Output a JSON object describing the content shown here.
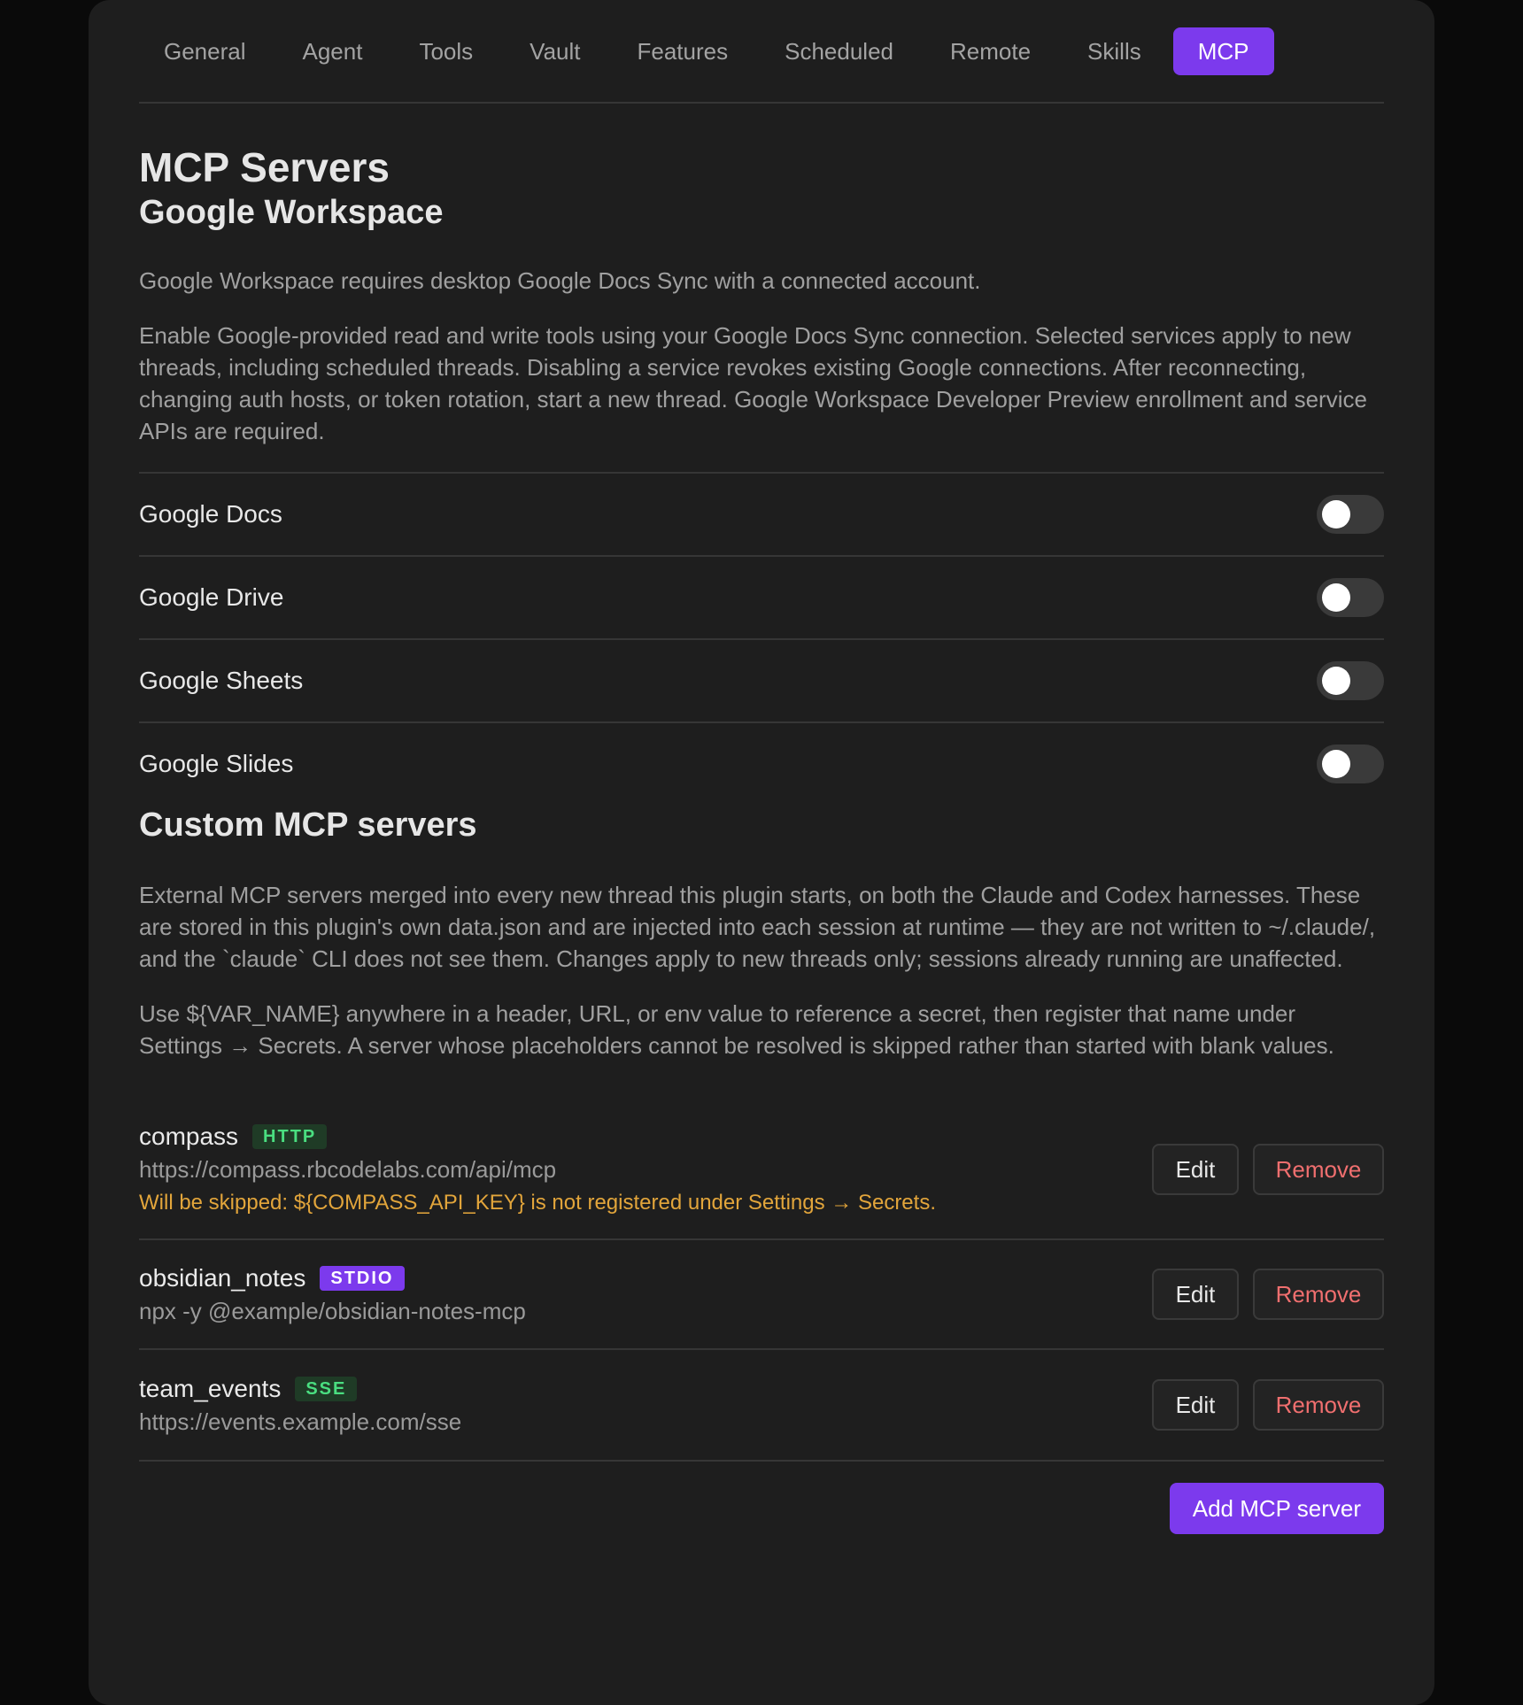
{
  "tabs": [
    {
      "label": "General"
    },
    {
      "label": "Agent"
    },
    {
      "label": "Tools"
    },
    {
      "label": "Vault"
    },
    {
      "label": "Features"
    },
    {
      "label": "Scheduled"
    },
    {
      "label": "Remote"
    },
    {
      "label": "Skills"
    },
    {
      "label": "MCP",
      "active": true
    }
  ],
  "page_title": "MCP Servers",
  "google_workspace": {
    "title": "Google Workspace",
    "requirement": "Google Workspace requires desktop Google Docs Sync with a connected account.",
    "description": "Enable Google-provided read and write tools using your Google Docs Sync connection. Selected services apply to new threads, including scheduled threads. Disabling a service revokes existing Google connections. After reconnecting, changing auth hosts, or token rotation, start a new thread. Google Workspace Developer Preview enrollment and service APIs are required.",
    "services": [
      {
        "label": "Google Docs",
        "enabled": false
      },
      {
        "label": "Google Drive",
        "enabled": false
      },
      {
        "label": "Google Sheets",
        "enabled": false
      },
      {
        "label": "Google Slides",
        "enabled": false
      }
    ]
  },
  "custom": {
    "title": "Custom MCP servers",
    "description1": "External MCP servers merged into every new thread this plugin starts, on both the Claude and Codex harnesses. These are stored in this plugin's own data.json and are injected into each session at runtime — they are not written to ~/.claude/, and the `claude` CLI does not see them. Changes apply to new threads only; sessions already running are unaffected.",
    "description2": "Use ${VAR_NAME} anywhere in a header, URL, or env value to reference a secret, then register that name under Settings → Secrets. A server whose placeholders cannot be resolved is skipped rather than started with blank values.",
    "servers": [
      {
        "name": "compass",
        "type": "HTTP",
        "url": "https://compass.rbcodelabs.com/api/mcp",
        "warning": "Will be skipped: ${COMPASS_API_KEY} is not registered under Settings → Secrets.",
        "edit_label": "Edit",
        "remove_label": "Remove"
      },
      {
        "name": "obsidian_notes",
        "type": "STDIO",
        "url": "npx -y @example/obsidian-notes-mcp",
        "edit_label": "Edit",
        "remove_label": "Remove"
      },
      {
        "name": "team_events",
        "type": "SSE",
        "url": "https://events.example.com/sse",
        "edit_label": "Edit",
        "remove_label": "Remove"
      }
    ],
    "add_label": "Add MCP server"
  },
  "colors": {
    "accent": "#7c3aed",
    "panel_bg": "#1e1e1e",
    "warning": "#e2a53b",
    "danger": "#f06f6f",
    "badge_green": "#4ade80"
  }
}
